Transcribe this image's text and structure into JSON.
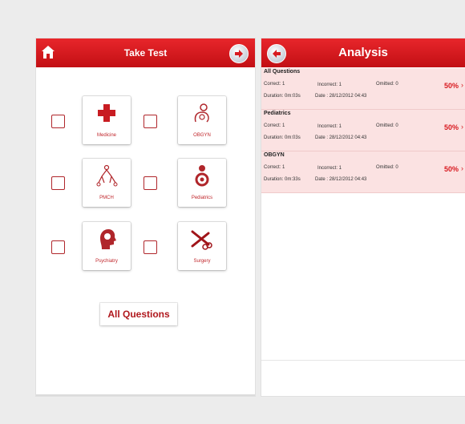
{
  "left_screen": {
    "title": "Take Test",
    "tiles": [
      {
        "label": "Medicine",
        "icon": "medical-cross-icon"
      },
      {
        "label": "OBGYN",
        "icon": "pregnancy-icon"
      },
      {
        "label": "PMCH",
        "icon": "family-tree-icon"
      },
      {
        "label": "Pediatrics",
        "icon": "mother-child-icon"
      },
      {
        "label": "Psychiatry",
        "icon": "head-brain-icon"
      },
      {
        "label": "Surgery",
        "icon": "scissors-icon"
      }
    ],
    "all_questions_label": "All Questions"
  },
  "right_screen": {
    "title": "Analysis",
    "results": [
      {
        "name": "All Questions",
        "correct": "Correct: 1",
        "incorrect": "Incorrect: 1",
        "omitted": "Omitted: 0",
        "percent": "50%",
        "duration": "Duration: 0m:03s",
        "date": "Date : 28/12/2012 04:43"
      },
      {
        "name": "Pediatrics",
        "correct": "Correct: 1",
        "incorrect": "Incorrect: 1",
        "omitted": "Omitted: 0",
        "percent": "50%",
        "duration": "Duration: 0m:03s",
        "date": "Date : 28/12/2012 04:43"
      },
      {
        "name": "OBGYN",
        "correct": "Correct: 1",
        "incorrect": "Incorrect: 1",
        "omitted": "Omitted: 0",
        "percent": "50%",
        "duration": "Duration: 0m:33s",
        "date": "Date : 28/12/2012 04:43"
      }
    ]
  },
  "colors": {
    "brand_red": "#d81a20",
    "highlight_row": "#fbe2e2",
    "background": "#ececec"
  }
}
